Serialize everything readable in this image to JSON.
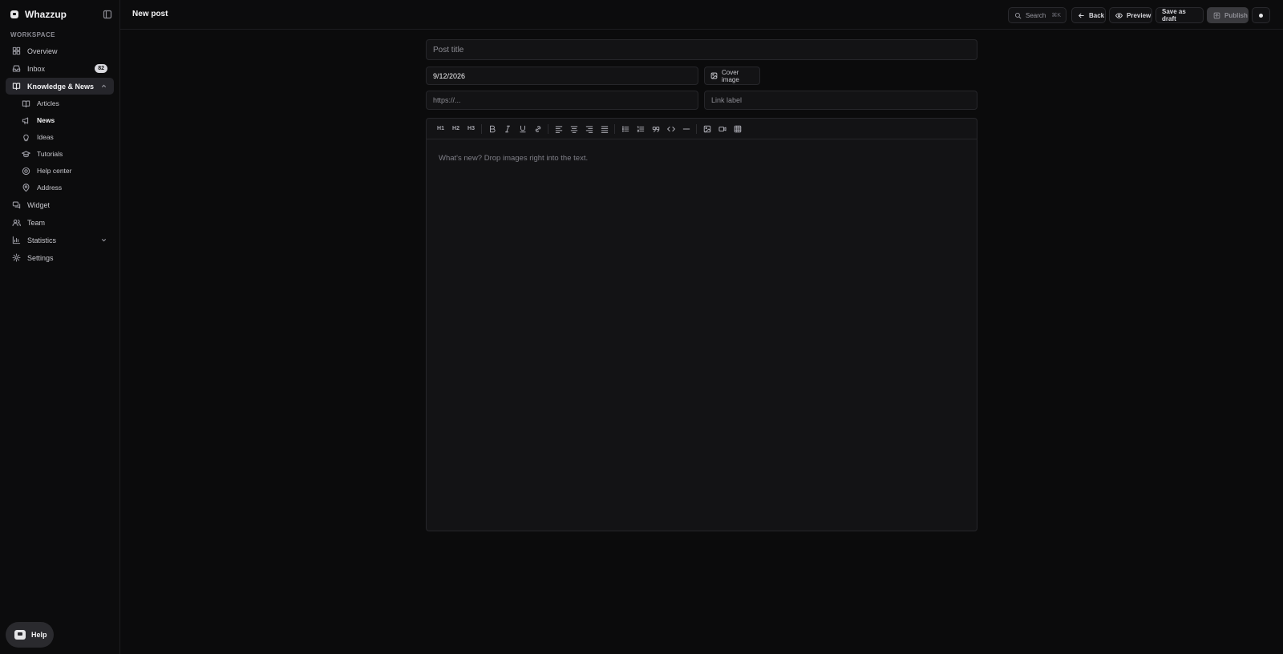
{
  "app": {
    "name": "Whazzup"
  },
  "sidebar": {
    "section_label": "WORKSPACE",
    "items": [
      {
        "label": "Overview",
        "icon": "grid-icon"
      },
      {
        "label": "Inbox",
        "icon": "inbox-icon",
        "badge": "82"
      },
      {
        "label": "Knowledge & News",
        "icon": "book-icon",
        "expanded": true
      },
      {
        "label": "Widget",
        "icon": "chat-icon"
      },
      {
        "label": "Team",
        "icon": "users-icon"
      },
      {
        "label": "Statistics",
        "icon": "chart-icon"
      },
      {
        "label": "Settings",
        "icon": "gear-icon"
      }
    ],
    "sub_items": [
      {
        "label": "Articles",
        "icon": "book-open-icon"
      },
      {
        "label": "News",
        "icon": "megaphone-icon",
        "current": true
      },
      {
        "label": "Ideas",
        "icon": "lightbulb-icon"
      },
      {
        "label": "Tutorials",
        "icon": "graduation-icon"
      },
      {
        "label": "Help center",
        "icon": "lifebuoy-icon"
      },
      {
        "label": "Address",
        "icon": "pin-icon"
      }
    ],
    "help_label": "Help"
  },
  "header": {
    "title": "New post",
    "search_label": "Search",
    "search_shortcut": "⌘K",
    "back_label": "Back",
    "preview_label": "Preview",
    "draft_label": "Save as draft",
    "publish_label": "Publish"
  },
  "form": {
    "title_placeholder": "Post title",
    "date_value": "9/12/2026",
    "cover_label": "Cover image",
    "url_placeholder": "https://...",
    "link_label_placeholder": "Link label",
    "editor_placeholder": "What's new? Drop images right into the text."
  },
  "toolbar": {
    "h1": "H1",
    "h2": "H2",
    "h3": "H3"
  },
  "colors": {
    "background": "#0b0b0c",
    "panel": "#131315",
    "accent": "#e6e6e8"
  }
}
